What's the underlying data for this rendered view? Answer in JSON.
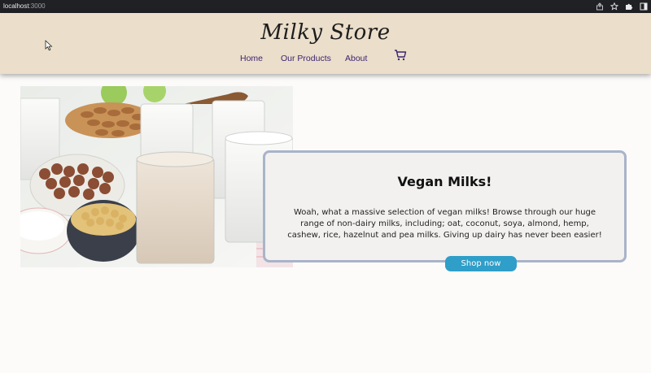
{
  "browser": {
    "url_host": "localhost",
    "url_port": ":3000",
    "icons": [
      "share-icon",
      "star-icon",
      "extensions-icon",
      "sidebar-icon"
    ]
  },
  "header": {
    "logo": "Milky Store",
    "nav": [
      {
        "label": "Home"
      },
      {
        "label": "Our Products"
      },
      {
        "label": "About"
      }
    ],
    "cart_icon": "cart-icon"
  },
  "hero": {
    "image_subject": "glasses of plant milk with almonds, hazelnuts, soybeans and rice",
    "title": "Vegan Milks!",
    "description": "Woah, what a massive selection of vegan milks! Browse through our huge range of non-dairy milks, including; oat, coconut, soya, almond, hemp, cashew, rice, hazelnut and pea milks. Giving up dairy has never been easier!",
    "button_label": "Shop now"
  },
  "colors": {
    "header_bg": "#ebdeca",
    "nav_text": "#3c2470",
    "card_border": "#a8b4c9",
    "button_bg": "#2f9ec8"
  }
}
